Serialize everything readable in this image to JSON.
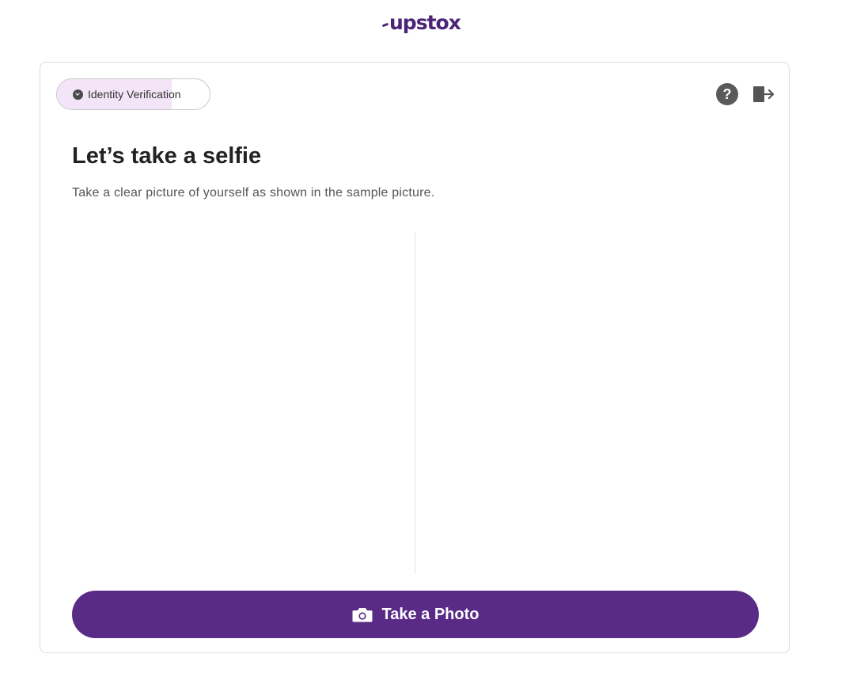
{
  "brand": {
    "logo_text": "upstox",
    "color": "#4b2477"
  },
  "progress": {
    "step_label": "Identity Verification",
    "fill_fraction": 0.75,
    "fill_color": "#f3e5f7"
  },
  "header_icons": {
    "help": "question-mark-icon",
    "help_glyph": "?",
    "logout": "logout-icon"
  },
  "main": {
    "title": "Let’s take a selfie",
    "description": "Take a clear picture of yourself as shown in the sample picture."
  },
  "action": {
    "button_label": "Take a Photo",
    "button_icon": "camera-icon",
    "button_color": "#5a2a87"
  }
}
